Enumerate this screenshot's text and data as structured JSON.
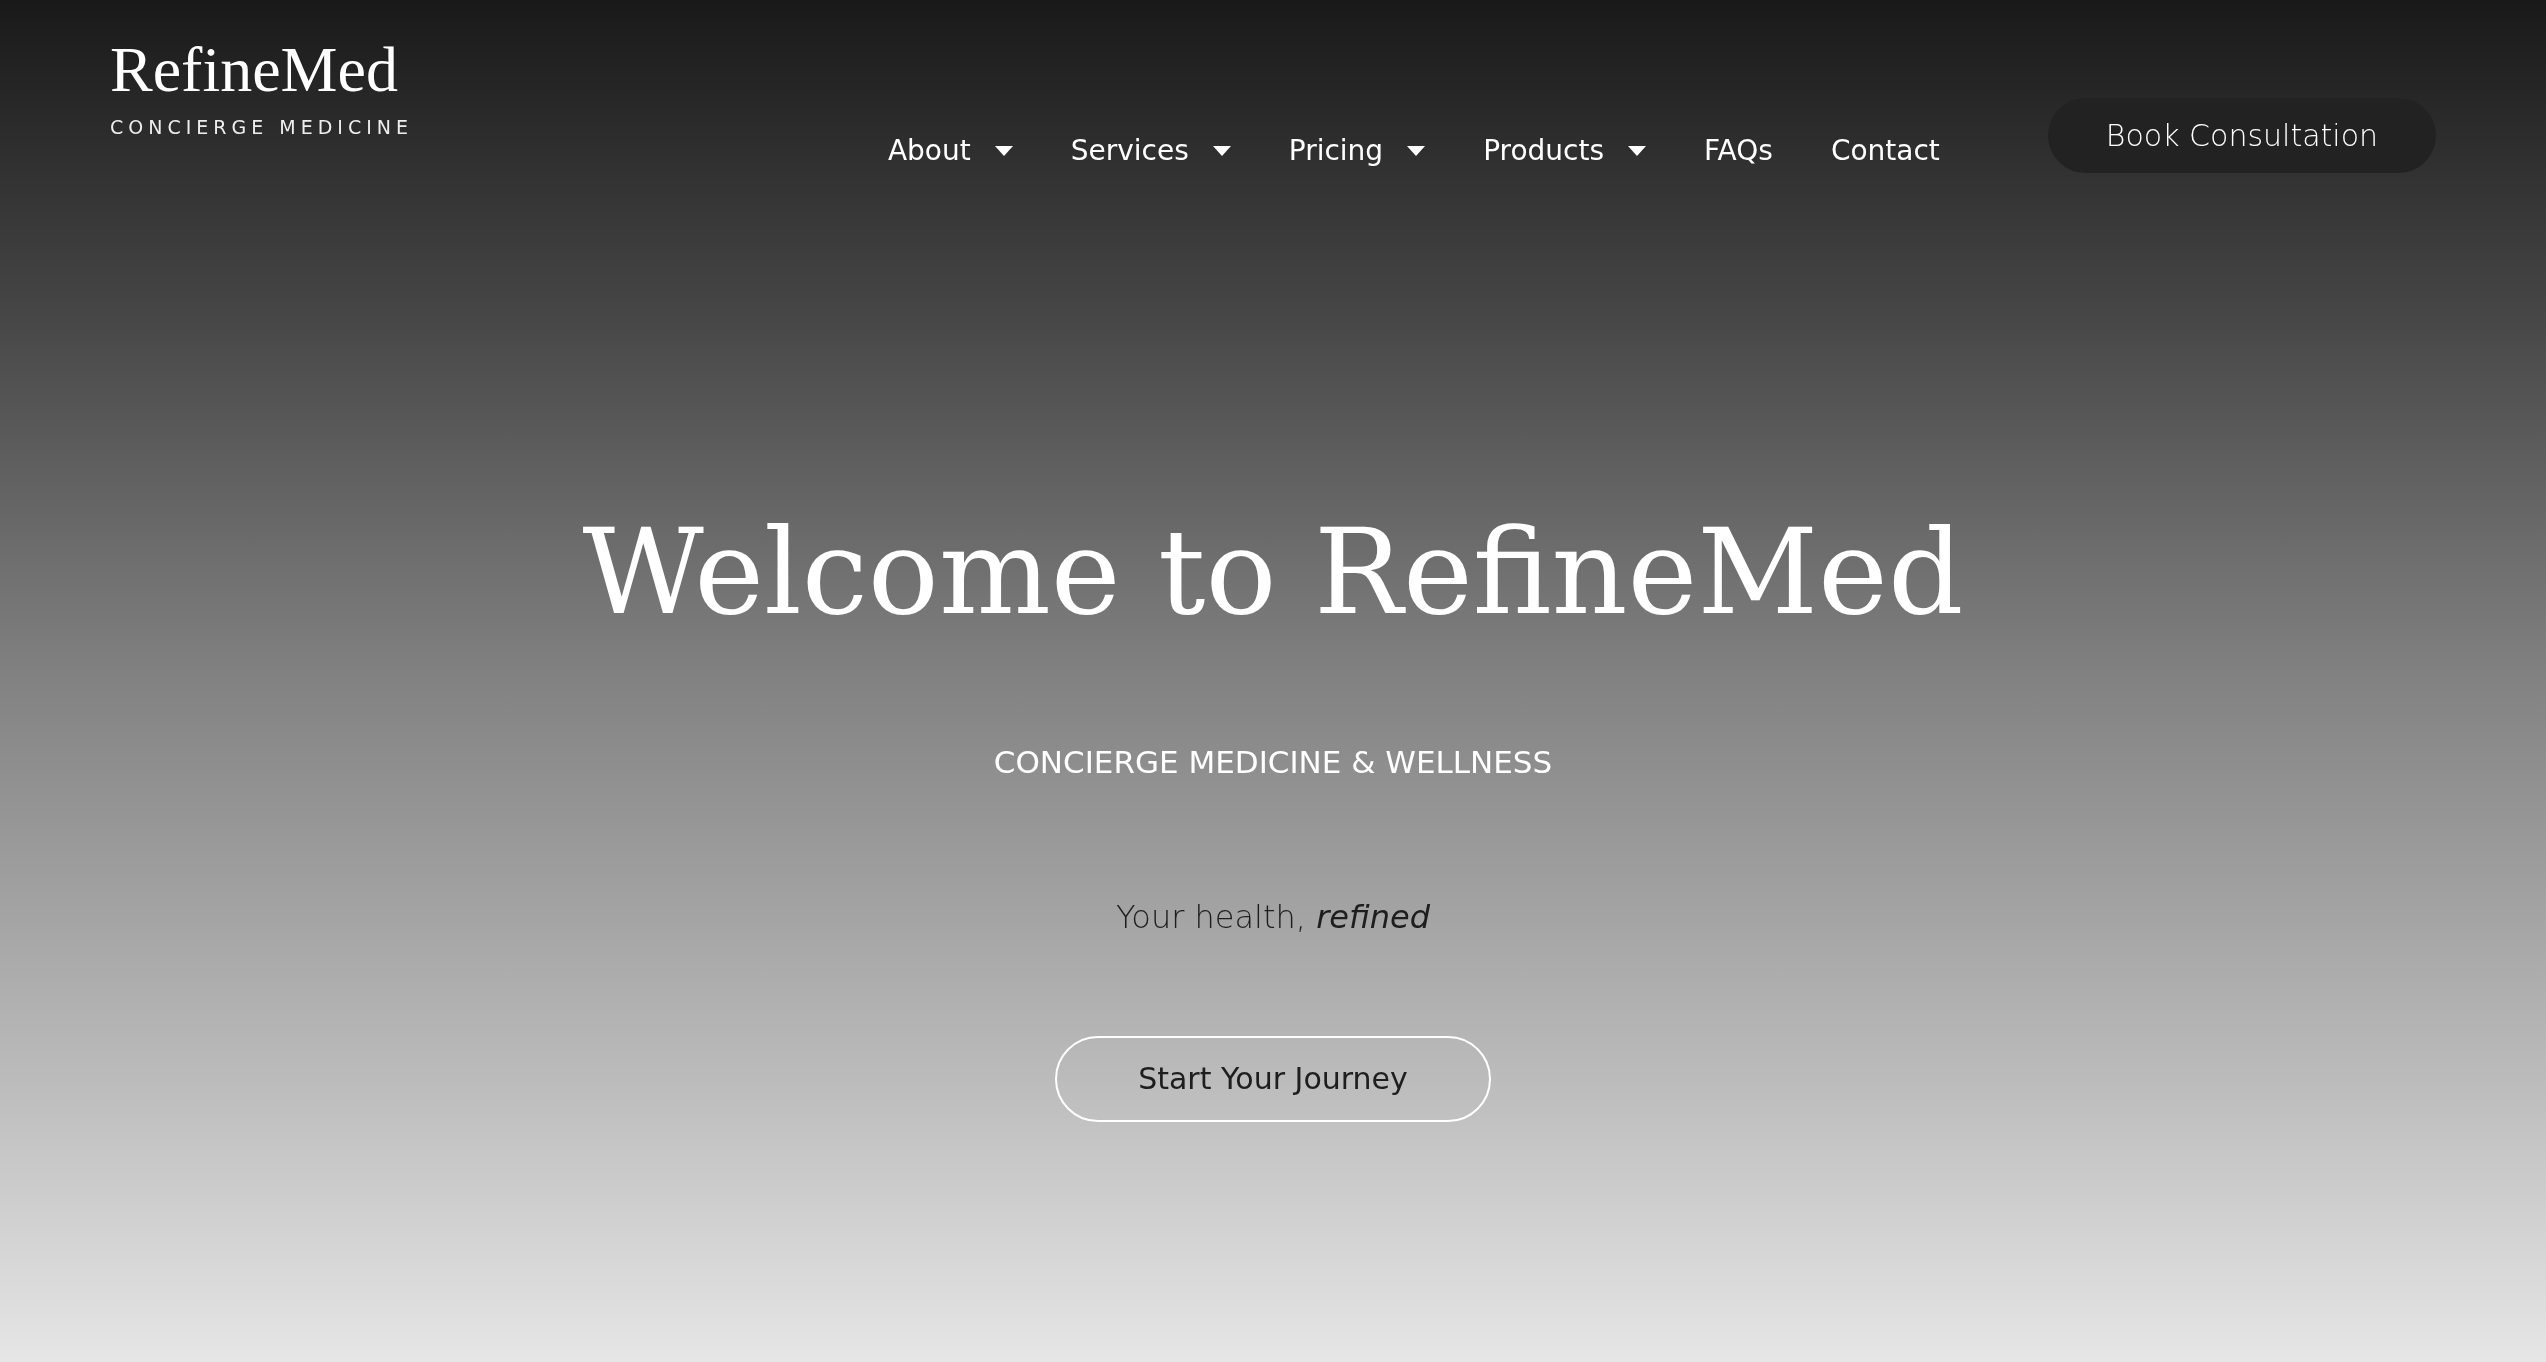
{
  "logo": {
    "name": "RefineMed",
    "tagline": "CONCIERGE MEDICINE"
  },
  "nav": [
    {
      "label": "About",
      "dropdown": true
    },
    {
      "label": "Services",
      "dropdown": true
    },
    {
      "label": "Pricing",
      "dropdown": true
    },
    {
      "label": "Products",
      "dropdown": true
    },
    {
      "label": "FAQs",
      "dropdown": false
    },
    {
      "label": "Contact",
      "dropdown": false
    }
  ],
  "cta_button": "Book Consultation",
  "hero": {
    "title": "Welcome to RefineMed",
    "subtitle": "CONCIERGE MEDICINE & WELLNESS",
    "tagline": "Your health, *refined*",
    "button": "Start Your Journey"
  }
}
